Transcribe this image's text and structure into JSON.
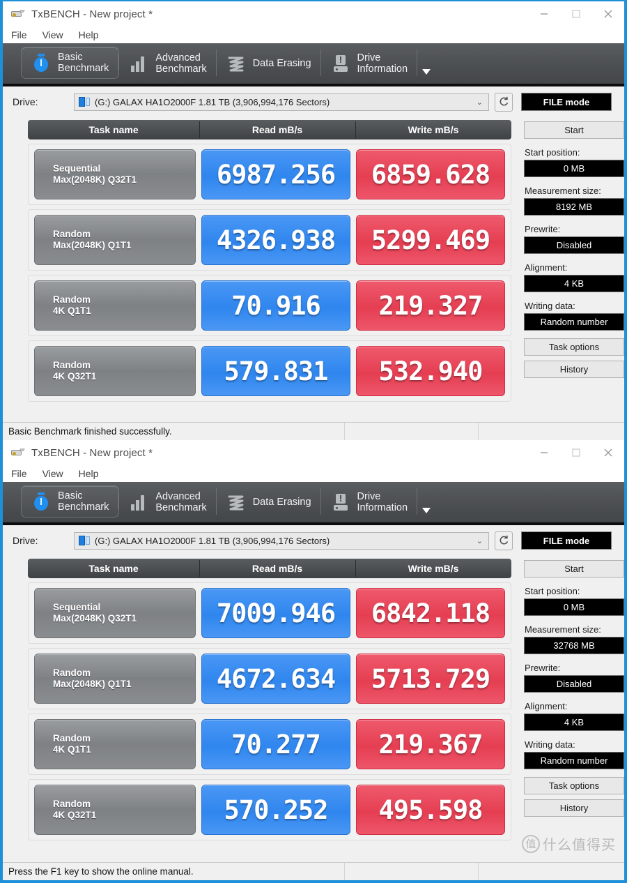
{
  "window": {
    "title": "TxBENCH - New project *",
    "icon": "drive-app-icon",
    "controls": {
      "minimize": "minimize-icon",
      "maximize": "maximize-icon",
      "close": "close-icon"
    }
  },
  "menu": {
    "items": [
      "File",
      "View",
      "Help"
    ]
  },
  "tabs": [
    {
      "icon": "stopwatch-icon",
      "line1": "Basic",
      "line2": "Benchmark",
      "active": true
    },
    {
      "icon": "bar-chart-icon",
      "line1": "Advanced",
      "line2": "Benchmark",
      "active": false
    },
    {
      "icon": "data-erase-icon",
      "line1": "Data Erasing",
      "line2": "",
      "active": false
    },
    {
      "icon": "drive-info-icon",
      "line1": "Drive",
      "line2": "Information",
      "active": false
    }
  ],
  "tabs_overflow_icon": "chevron-down-icon",
  "drive": {
    "label": "Drive:",
    "icon": "drive-icon",
    "value": "(G:) GALAX HA1O2000F  1.81 TB (3,906,994,176 Sectors)",
    "dropdown_icon": "chevron-down-icon",
    "refresh_icon": "refresh-icon",
    "mode_button": "FILE mode"
  },
  "table": {
    "headers": [
      "Task name",
      "Read mB/s",
      "Write mB/s"
    ]
  },
  "colors": {
    "read": "#3a8ef2",
    "write": "#e8495c",
    "accent_border": "#1e90d8",
    "tab_bar": "#4c4f52"
  },
  "panels": [
    {
      "id": "panel-top",
      "status": "Basic Benchmark finished successfully.",
      "sidebar": {
        "start_button": "Start",
        "fields": [
          {
            "label": "Start position:",
            "value": "0 MB"
          },
          {
            "label": "Measurement size:",
            "value": "8192 MB"
          },
          {
            "label": "Prewrite:",
            "value": "Disabled"
          },
          {
            "label": "Alignment:",
            "value": "4 KB"
          },
          {
            "label": "Writing data:",
            "value": "Random number"
          }
        ],
        "task_options_button": "Task options",
        "history_button": "History"
      },
      "rows": [
        {
          "name1": "Sequential",
          "name2": "Max(2048K) Q32T1",
          "read": "6987.256",
          "write": "6859.628"
        },
        {
          "name1": "Random",
          "name2": "Max(2048K) Q1T1",
          "read": "4326.938",
          "write": "5299.469"
        },
        {
          "name1": "Random",
          "name2": "4K Q1T1",
          "read": "70.916",
          "write": "219.327"
        },
        {
          "name1": "Random",
          "name2": "4K Q32T1",
          "read": "579.831",
          "write": "532.940"
        }
      ]
    },
    {
      "id": "panel-bottom",
      "status": "Press the F1 key to show the online manual.",
      "sidebar": {
        "start_button": "Start",
        "fields": [
          {
            "label": "Start position:",
            "value": "0 MB"
          },
          {
            "label": "Measurement size:",
            "value": "32768 MB"
          },
          {
            "label": "Prewrite:",
            "value": "Disabled"
          },
          {
            "label": "Alignment:",
            "value": "4 KB"
          },
          {
            "label": "Writing data:",
            "value": "Random number"
          }
        ],
        "task_options_button": "Task options",
        "history_button": "History"
      },
      "rows": [
        {
          "name1": "Sequential",
          "name2": "Max(2048K) Q32T1",
          "read": "7009.946",
          "write": "6842.118"
        },
        {
          "name1": "Random",
          "name2": "Max(2048K) Q1T1",
          "read": "4672.634",
          "write": "5713.729"
        },
        {
          "name1": "Random",
          "name2": "4K Q1T1",
          "read": "70.277",
          "write": "219.367"
        },
        {
          "name1": "Random",
          "name2": "4K Q32T1",
          "read": "570.252",
          "write": "495.598"
        }
      ]
    }
  ],
  "watermark": {
    "badge": "值",
    "text": "什么值得买"
  },
  "chart_data": {
    "type": "bar",
    "title": "TxBENCH Basic Benchmark results (mB/s)",
    "categories": [
      "Sequential Max(2048K) Q32T1",
      "Random Max(2048K) Q1T1",
      "Random 4K Q1T1",
      "Random 4K Q32T1"
    ],
    "series": [
      {
        "name": "Read mB/s 8192 MB",
        "values": [
          6987.256,
          4326.938,
          70.916,
          579.831
        ]
      },
      {
        "name": "Write mB/s 8192 MB",
        "values": [
          6859.628,
          5299.469,
          219.327,
          532.94
        ]
      },
      {
        "name": "Read mB/s 32768 MB",
        "values": [
          7009.946,
          4672.634,
          70.277,
          570.252
        ]
      },
      {
        "name": "Write mB/s 32768 MB",
        "values": [
          6842.118,
          5713.729,
          219.367,
          495.598
        ]
      }
    ],
    "xlabel": "Task name",
    "ylabel": "mB/s"
  }
}
